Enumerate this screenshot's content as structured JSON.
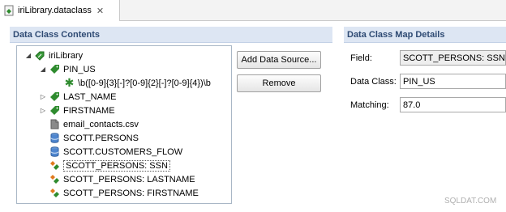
{
  "editor_tab": {
    "title": "iriLibrary.dataclass",
    "close_glyph": "✕"
  },
  "left_section": {
    "title": "Data Class Contents"
  },
  "right_section": {
    "title": "Data Class Map Details"
  },
  "tree": {
    "root": {
      "label": "iriLibrary",
      "icon": "library-icon"
    },
    "items": [
      {
        "label": "PIN_US",
        "icon": "tag-icon",
        "expanded": true
      },
      {
        "label": "\\b([0-9]{3}[-]?[0-9]{2}[-]?[0-9]{4})\\b",
        "icon": "regex-icon"
      },
      {
        "label": "LAST_NAME",
        "icon": "tag-icon",
        "expanded": false
      },
      {
        "label": "FIRSTNAME",
        "icon": "tag-icon",
        "expanded": false
      },
      {
        "label": "email_contacts.csv",
        "icon": "file-icon"
      },
      {
        "label": "SCOTT.PERSONS",
        "icon": "database-icon"
      },
      {
        "label": "SCOTT.CUSTOMERS_FLOW",
        "icon": "database-icon"
      },
      {
        "label": "SCOTT_PERSONS: SSN",
        "icon": "column-map-icon",
        "selected": true
      },
      {
        "label": "SCOTT_PERSONS: LASTNAME",
        "icon": "column-map-icon"
      },
      {
        "label": "SCOTT_PERSONS: FIRSTNAME",
        "icon": "column-map-icon"
      }
    ]
  },
  "buttons": {
    "add_data_source": "Add Data Source...",
    "remove": "Remove"
  },
  "details": {
    "field_label": "Field:",
    "field_value": "SCOTT_PERSONS: SSN",
    "data_class_label": "Data Class:",
    "data_class_value": "PIN_US",
    "matching_label": "Matching:",
    "matching_value": "87.0"
  },
  "watermark": "SQLDAT.COM",
  "colors": {
    "section_header_bg": "#dde6f3",
    "section_header_text": "#2e4a73",
    "tag_green": "#2e8b2e"
  }
}
